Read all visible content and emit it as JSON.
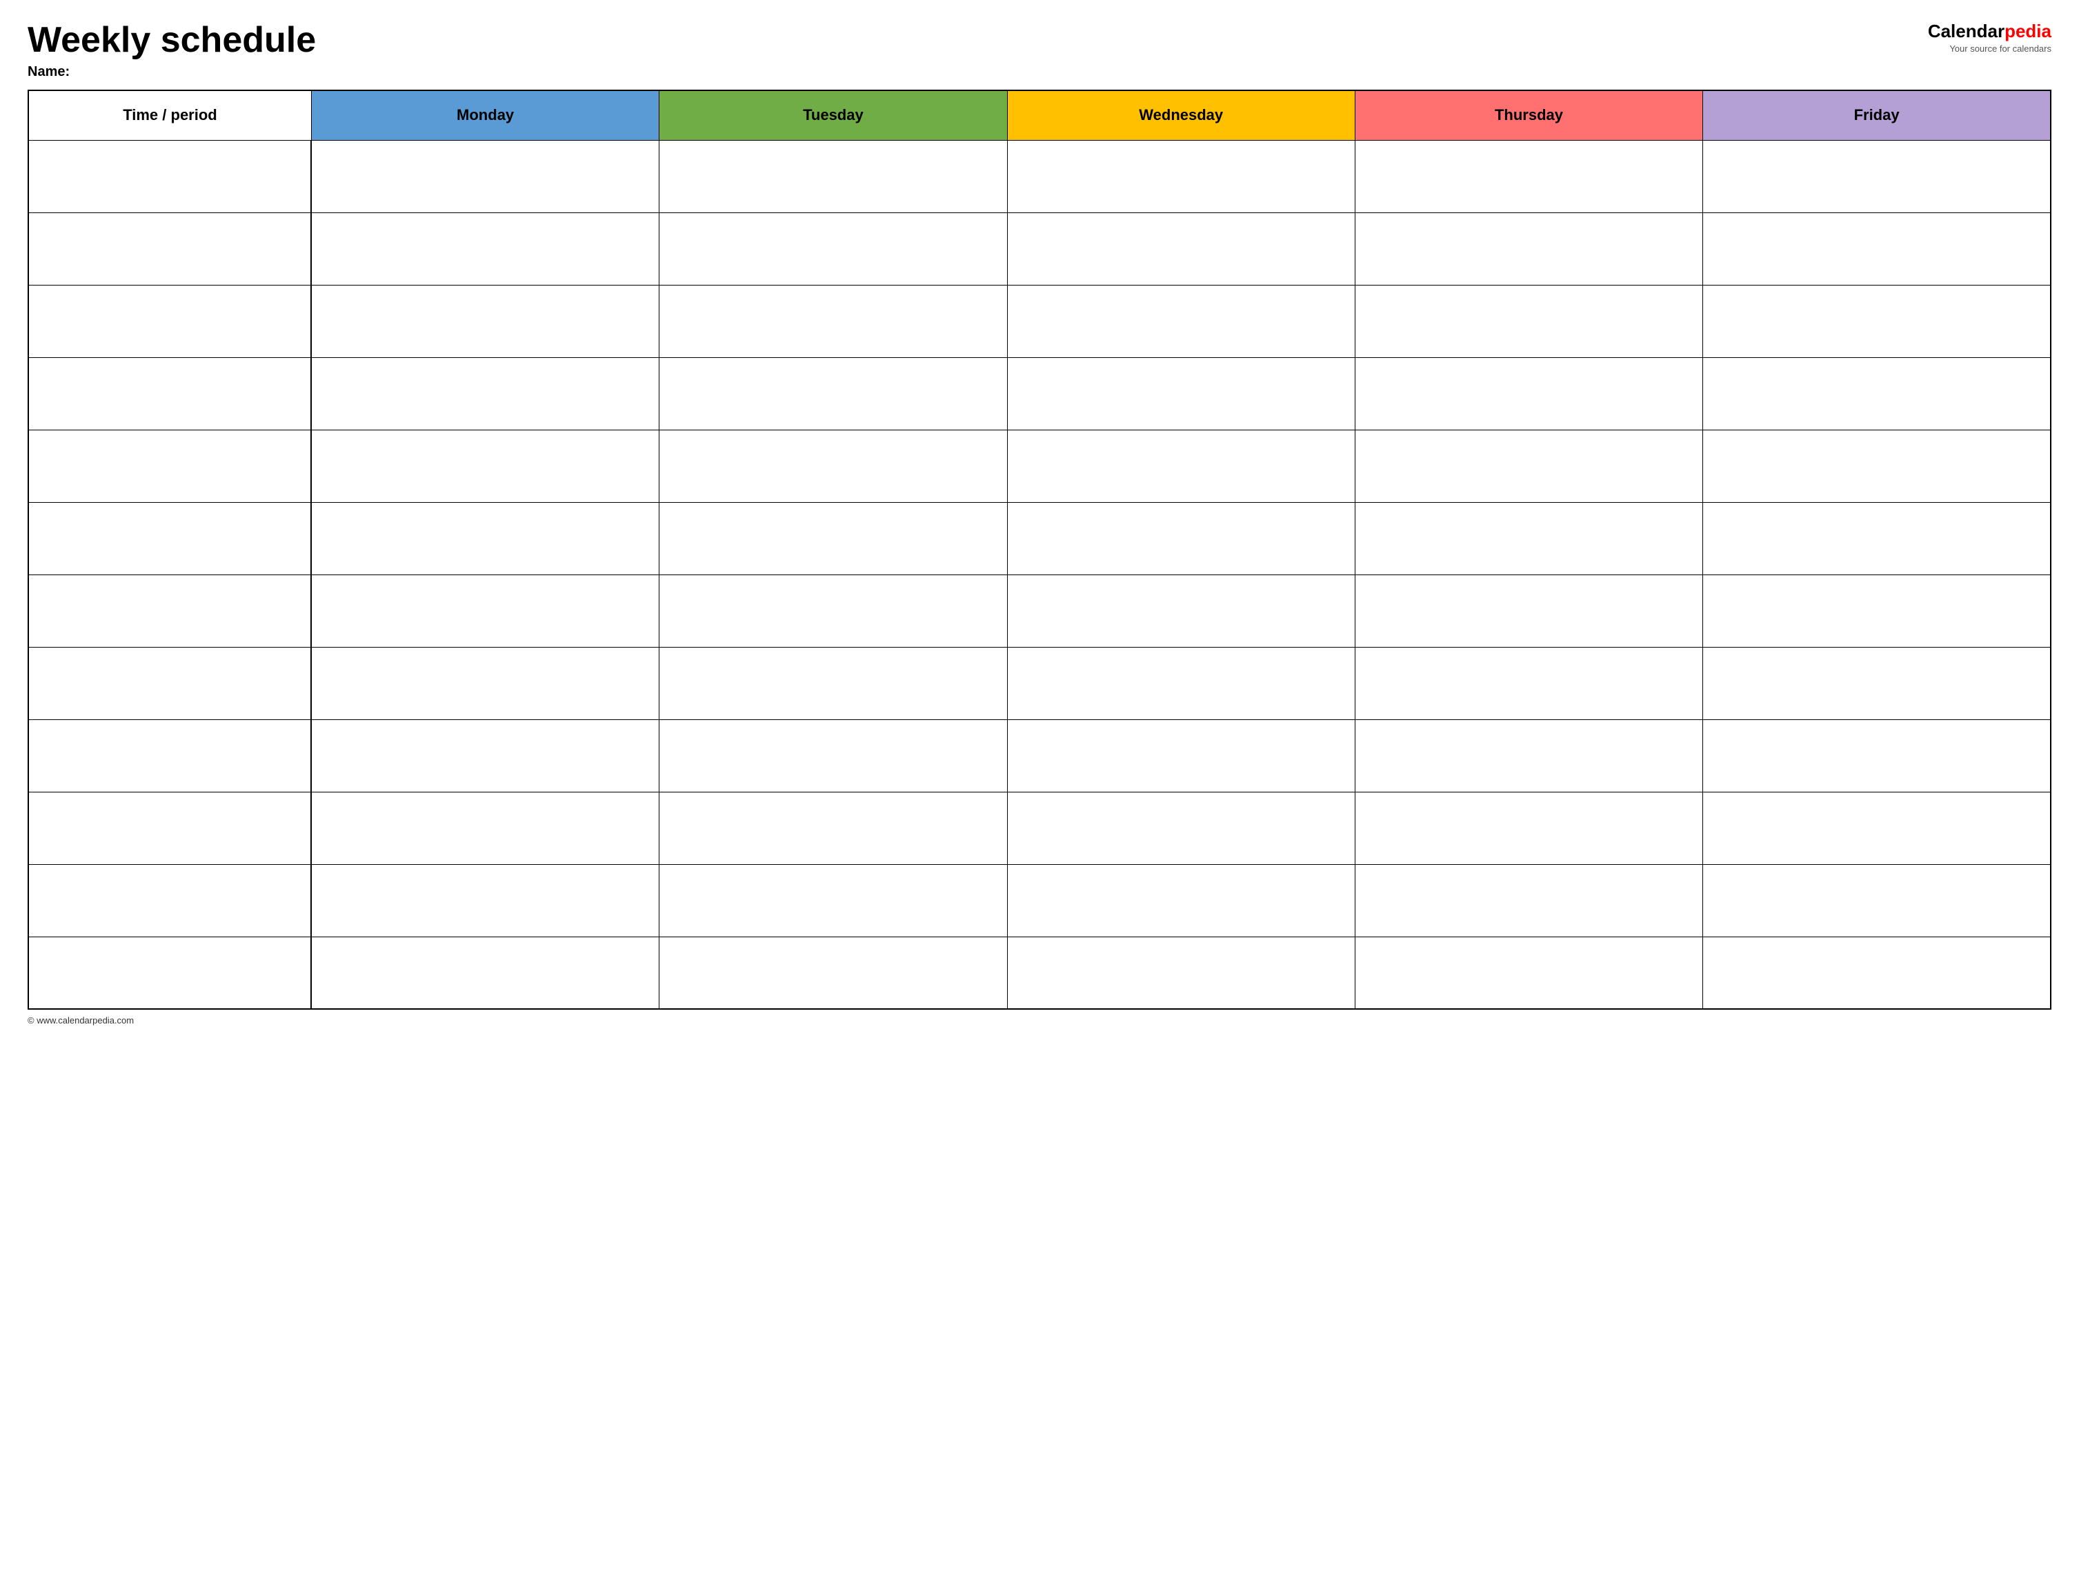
{
  "header": {
    "title": "Weekly schedule",
    "name_label": "Name:",
    "logo": {
      "calendar_part": "Calendar",
      "pedia_part": "pedia",
      "tagline": "Your source for calendars"
    }
  },
  "table": {
    "columns": [
      {
        "id": "time",
        "label": "Time / period",
        "color": "#ffffff"
      },
      {
        "id": "monday",
        "label": "Monday",
        "color": "#5b9bd5"
      },
      {
        "id": "tuesday",
        "label": "Tuesday",
        "color": "#70ad47"
      },
      {
        "id": "wednesday",
        "label": "Wednesday",
        "color": "#ffc000"
      },
      {
        "id": "thursday",
        "label": "Thursday",
        "color": "#ff7070"
      },
      {
        "id": "friday",
        "label": "Friday",
        "color": "#b4a0d4"
      }
    ],
    "row_count": 12
  },
  "footer": {
    "text": "© www.calendarpedia.com"
  }
}
